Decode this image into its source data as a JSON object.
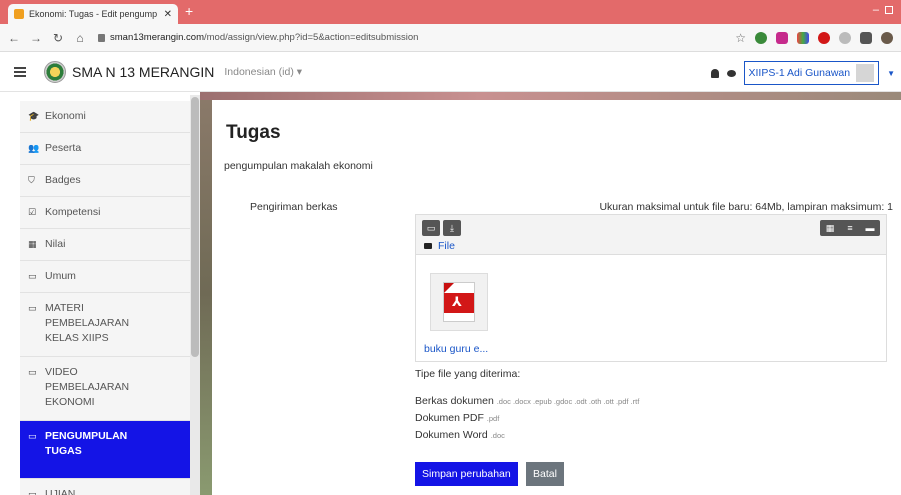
{
  "browser": {
    "tab_title": "Ekonomi: Tugas - Edit pengump",
    "url_domain": "sman13merangin.com",
    "url_path": "/mod/assign/view.php?id=5&action=editsubmission"
  },
  "navbar": {
    "site_name": "SMA N 13 MERANGIN",
    "language": "Indonesian (id) ▾",
    "user_name": "XIIPS-1 Adi Gunawan"
  },
  "sidebar": {
    "items": [
      {
        "label": "Ekonomi",
        "icon": "graduation-cap-icon",
        "glyph": "🎓"
      },
      {
        "label": "Peserta",
        "icon": "users-icon",
        "glyph": "👥"
      },
      {
        "label": "Badges",
        "icon": "shield-icon",
        "glyph": "⛉"
      },
      {
        "label": "Kompetensi",
        "icon": "checkbox-icon",
        "glyph": "☑"
      },
      {
        "label": "Nilai",
        "icon": "table-icon",
        "glyph": "▦"
      },
      {
        "label": "Umum",
        "icon": "folder-icon",
        "glyph": "▭"
      },
      {
        "label": "MATERI PEMBELAJARAN KELAS XIIPS",
        "icon": "folder-icon",
        "glyph": "▭"
      },
      {
        "label": "VIDEO PEMBELAJARAN EKONOMI",
        "icon": "folder-icon",
        "glyph": "▭"
      },
      {
        "label": "PENGUMPULAN TUGAS",
        "icon": "folder-icon",
        "glyph": "▭"
      },
      {
        "label": "UJIAN",
        "icon": "folder-icon",
        "glyph": "▭"
      }
    ]
  },
  "main": {
    "title": "Tugas",
    "description": "pengumpulan makalah ekonomi",
    "field_label": "Pengiriman berkas",
    "max_size_text": "Ukuran maksimal untuk file baru: 64Mb, lampiran maksimum: 1",
    "file_manager": {
      "path_label": "File",
      "file_name": "buku guru e..."
    },
    "accepted_types_label": "Tipe file yang diterima:",
    "accepted_types": [
      {
        "name": "Berkas dokumen",
        "exts": ".doc .docx .epub .gdoc .odt .oth .ott .pdf .rtf"
      },
      {
        "name": "Dokumen PDF",
        "exts": ".pdf"
      },
      {
        "name": "Dokumen Word",
        "exts": ".doc"
      }
    ],
    "save_label": "Simpan perubahan",
    "cancel_label": "Batal"
  },
  "colors": {
    "accent": "#1414e6",
    "link": "#1a56c8",
    "browser_frame": "#e36a6a",
    "cancel": "#6c757d"
  }
}
